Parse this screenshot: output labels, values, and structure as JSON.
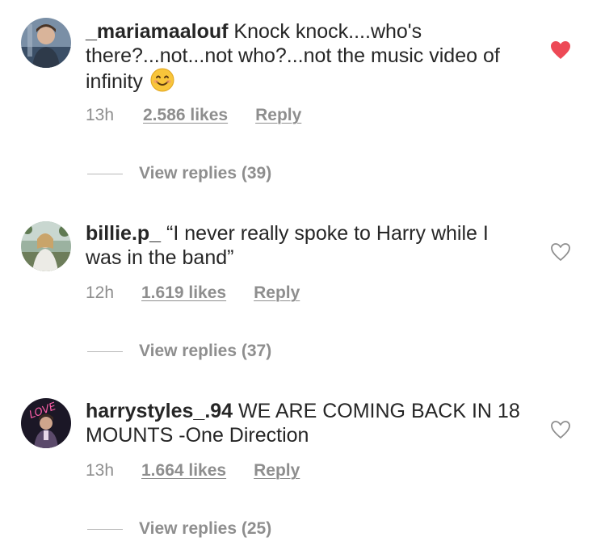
{
  "comments": [
    {
      "username": "_mariamaalouf",
      "text": "Knock knock....who's there?...not...not who?...not the music video of infinity",
      "emoji": "smiling-face-emoji",
      "time": "13h",
      "likes": "2.586 likes",
      "reply": "Reply",
      "liked": true,
      "view_replies": "View replies (39)"
    },
    {
      "username": "billie.p_",
      "text": "“I never really spoke to Harry while I was in the band”",
      "time": "12h",
      "likes": "1.619 likes",
      "reply": "Reply",
      "liked": false,
      "view_replies": "View replies (37)"
    },
    {
      "username": "harrystyles_.94",
      "text": "WE ARE COMING BACK IN 18 MOUNTS -One Direction",
      "time": "13h",
      "likes": "1.664 likes",
      "reply": "Reply",
      "liked": false,
      "view_replies": "View replies (25)"
    }
  ],
  "colors": {
    "text": "#262626",
    "meta": "#8e8e8e",
    "liked_heart": "#ed4956"
  }
}
